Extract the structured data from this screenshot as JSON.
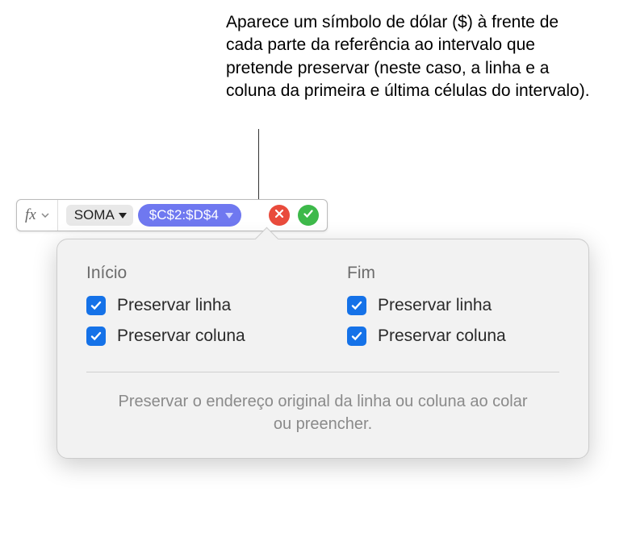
{
  "annotation": "Aparece um símbolo de dólar ($) à frente de cada parte da referência ao intervalo que pretende preservar (neste caso, a linha e a coluna da primeira e última células do intervalo).",
  "formula_bar": {
    "fx_label": "fx",
    "function_name": "SOMA",
    "range_reference": "$C$2:$D$4"
  },
  "popover": {
    "start": {
      "heading": "Início",
      "preserve_row": "Preservar linha",
      "preserve_column": "Preservar coluna"
    },
    "end": {
      "heading": "Fim",
      "preserve_row": "Preservar linha",
      "preserve_column": "Preservar coluna"
    },
    "footer": "Preservar o endereço original da linha ou coluna ao colar ou preencher."
  }
}
